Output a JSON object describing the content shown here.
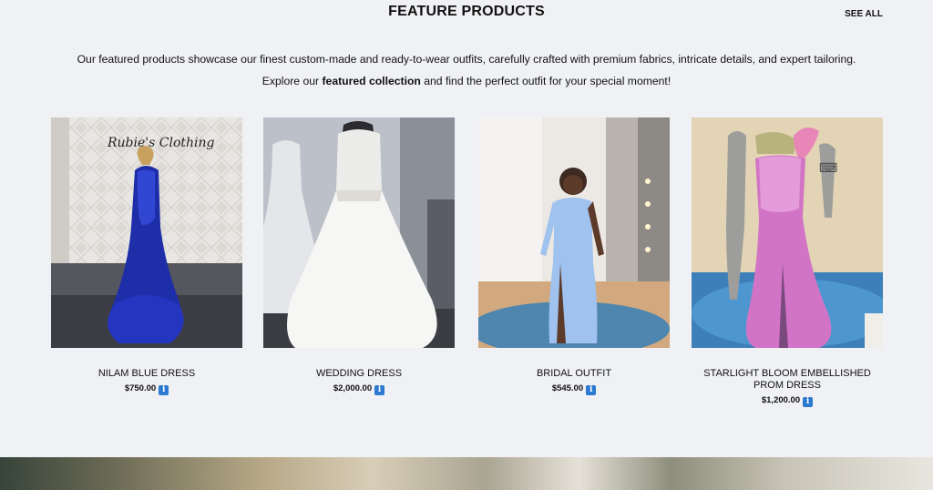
{
  "section": {
    "title": "FEATURE PRODUCTS",
    "see_all": "SEE ALL",
    "intro_line1": "Our featured products showcase our finest custom-made and ready-to-wear outfits, carefully crafted with premium fabrics, intricate details, and expert tailoring.",
    "intro_line2_pre": "Explore our ",
    "intro_line2_bold": "featured collection",
    "intro_line2_post": " and find the perfect outfit for your special moment!"
  },
  "products": [
    {
      "name": "NILAM BLUE DRESS",
      "price": "$750.00",
      "logo_text": "Rubie's Clothing"
    },
    {
      "name": "WEDDING DRESS",
      "price": "$2,000.00"
    },
    {
      "name": "BRIDAL OUTFIT",
      "price": "$545.00"
    },
    {
      "name": "STARLIGHT BLOOM EMBELLISHED PROM DRESS",
      "price": "$1,200.00"
    }
  ],
  "info_icon_glyph": "i",
  "colors": {
    "background": "#f0f1f4",
    "info_icon": "#2b79d0"
  }
}
